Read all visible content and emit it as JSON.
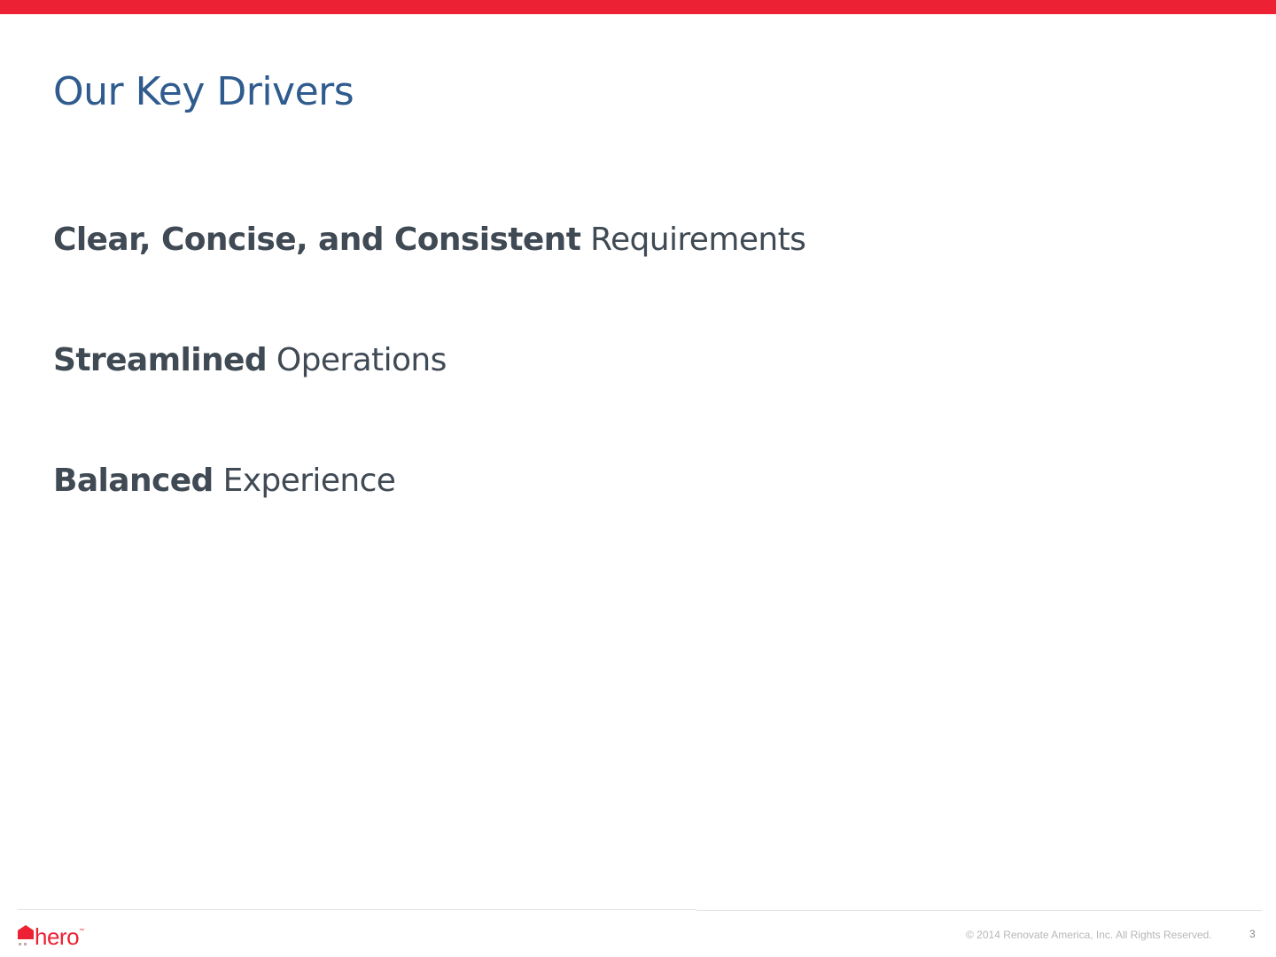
{
  "slide": {
    "title": "Our Key Drivers",
    "drivers": [
      {
        "bold": "Clear, Concise, and Consistent",
        "regular": " Requirements"
      },
      {
        "bold": "Streamlined",
        "regular": " Operations"
      },
      {
        "bold": "Balanced",
        "regular": " Experience"
      }
    ]
  },
  "footer": {
    "logo_text": "hero",
    "logo_tm": "™",
    "logo_icon": "house-roof-icon",
    "copyright": "© 2014 Renovate America, Inc. All Rights Reserved.",
    "page_number": "3"
  },
  "colors": {
    "accent": "#ec2133",
    "title": "#2f5b8e",
    "body_text": "#404a54"
  }
}
